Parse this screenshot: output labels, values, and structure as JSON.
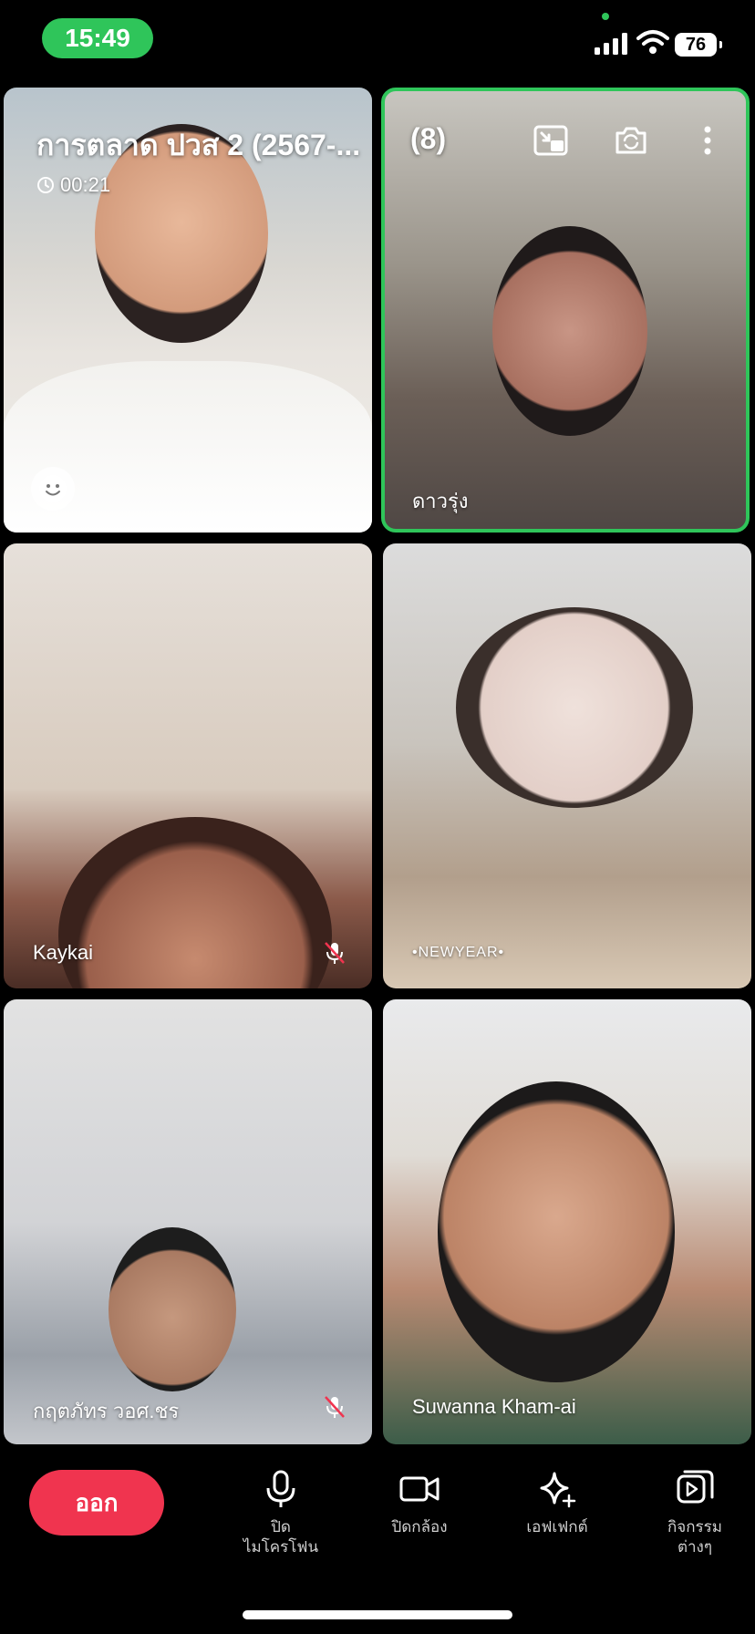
{
  "status_bar": {
    "time": "15:49",
    "battery": "76"
  },
  "call": {
    "title": "การตลาด ปวส 2 (2567-...",
    "participant_count": "(8)",
    "elapsed": "00:21"
  },
  "participants": [
    {
      "name": "",
      "muted": false,
      "active_speaker": false
    },
    {
      "name": "ดาวรุ่ง",
      "muted": false,
      "active_speaker": true
    },
    {
      "name": "Kaykai",
      "muted": true,
      "active_speaker": false
    },
    {
      "name": "•NEWYEAR•",
      "muted": false,
      "active_speaker": false
    },
    {
      "name": "กฤตภัทร วอศ.ชร",
      "muted": true,
      "active_speaker": false
    },
    {
      "name": "Suwanna Kham-ai",
      "muted": false,
      "active_speaker": false
    }
  ],
  "controls": {
    "leave": "ออก",
    "mic": "ปิด\nไมโครโฟน",
    "camera": "ปิดกล้อง",
    "effects": "เอฟเฟกต์",
    "activities": "กิจกรรม\nต่างๆ"
  },
  "colors": {
    "accent_green": "#2fc55a",
    "leave_red": "#f0344f"
  },
  "icons": [
    "signal-icon",
    "wifi-icon",
    "clock-icon",
    "minimize-screen-icon",
    "switch-camera-icon",
    "more-icon",
    "emoji-icon",
    "mic-off-icon",
    "microphone-icon",
    "camera-icon",
    "sparkles-icon",
    "activities-icon"
  ]
}
